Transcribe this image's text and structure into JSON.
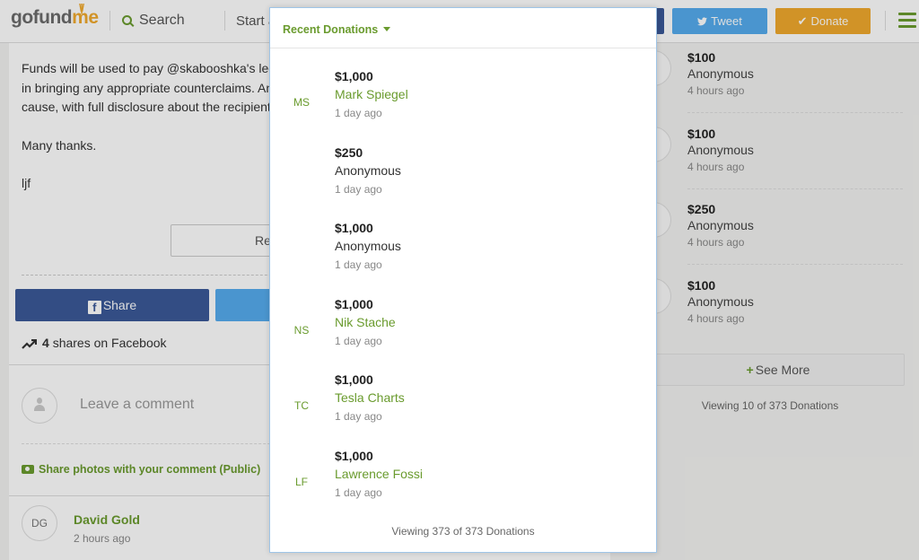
{
  "header": {
    "logo_main": "gofund",
    "logo_accent": "me",
    "search_label": "Search",
    "start_label": "Start a",
    "tweet_label": "Tweet",
    "donate_label": "Donate",
    "colors": {
      "brand_green": "#6a9b2e",
      "facebook": "#3b5998",
      "twitter": "#55acee",
      "donate": "#f0a92d"
    }
  },
  "story": {
    "paragraphs": [
      "Funds will be used to pay @skabooshka's lega",
      "in bringing any appropriate counterclaims. An",
      "cause, with full disclosure about the recipient"
    ],
    "thanks": "Many thanks.",
    "signature": "ljf",
    "read_more_label": "Re"
  },
  "share": {
    "facebook_label": "Share",
    "shares_count": "4",
    "shares_text": "shares on Facebook"
  },
  "comments": {
    "placeholder": "Leave a comment",
    "photos_link": "Share photos with your comment (Public)",
    "first": {
      "initials": "DG",
      "name": "David Gold",
      "time": "2 hours ago"
    }
  },
  "right_donations": {
    "items": [
      {
        "amount": "$100",
        "name": "Anonymous",
        "time": "4 hours ago"
      },
      {
        "amount": "$100",
        "name": "Anonymous",
        "time": "4 hours ago"
      },
      {
        "amount": "$250",
        "name": "Anonymous",
        "time": "4 hours ago"
      },
      {
        "amount": "$100",
        "name": "Anonymous",
        "time": "4 hours ago"
      }
    ],
    "see_more_label": "See More",
    "viewing_text": "Viewing 10 of 373 Donations"
  },
  "modal": {
    "title": "Recent Donations",
    "items": [
      {
        "initials": "MS",
        "amount": "$1,000",
        "name": "Mark Spiegel",
        "time": "1 day ago"
      },
      {
        "initials": "",
        "amount": "$250",
        "name": "Anonymous",
        "time": "1 day ago"
      },
      {
        "initials": "",
        "amount": "$1,000",
        "name": "Anonymous",
        "time": "1 day ago"
      },
      {
        "initials": "NS",
        "amount": "$1,000",
        "name": "Nik Stache",
        "time": "1 day ago"
      },
      {
        "initials": "TC",
        "amount": "$1,000",
        "name": "Tesla Charts",
        "time": "1 day ago"
      },
      {
        "initials": "LF",
        "amount": "$1,000",
        "name": "Lawrence Fossi",
        "time": "1 day ago"
      }
    ],
    "viewing_text": "Viewing 373 of 373 Donations"
  }
}
